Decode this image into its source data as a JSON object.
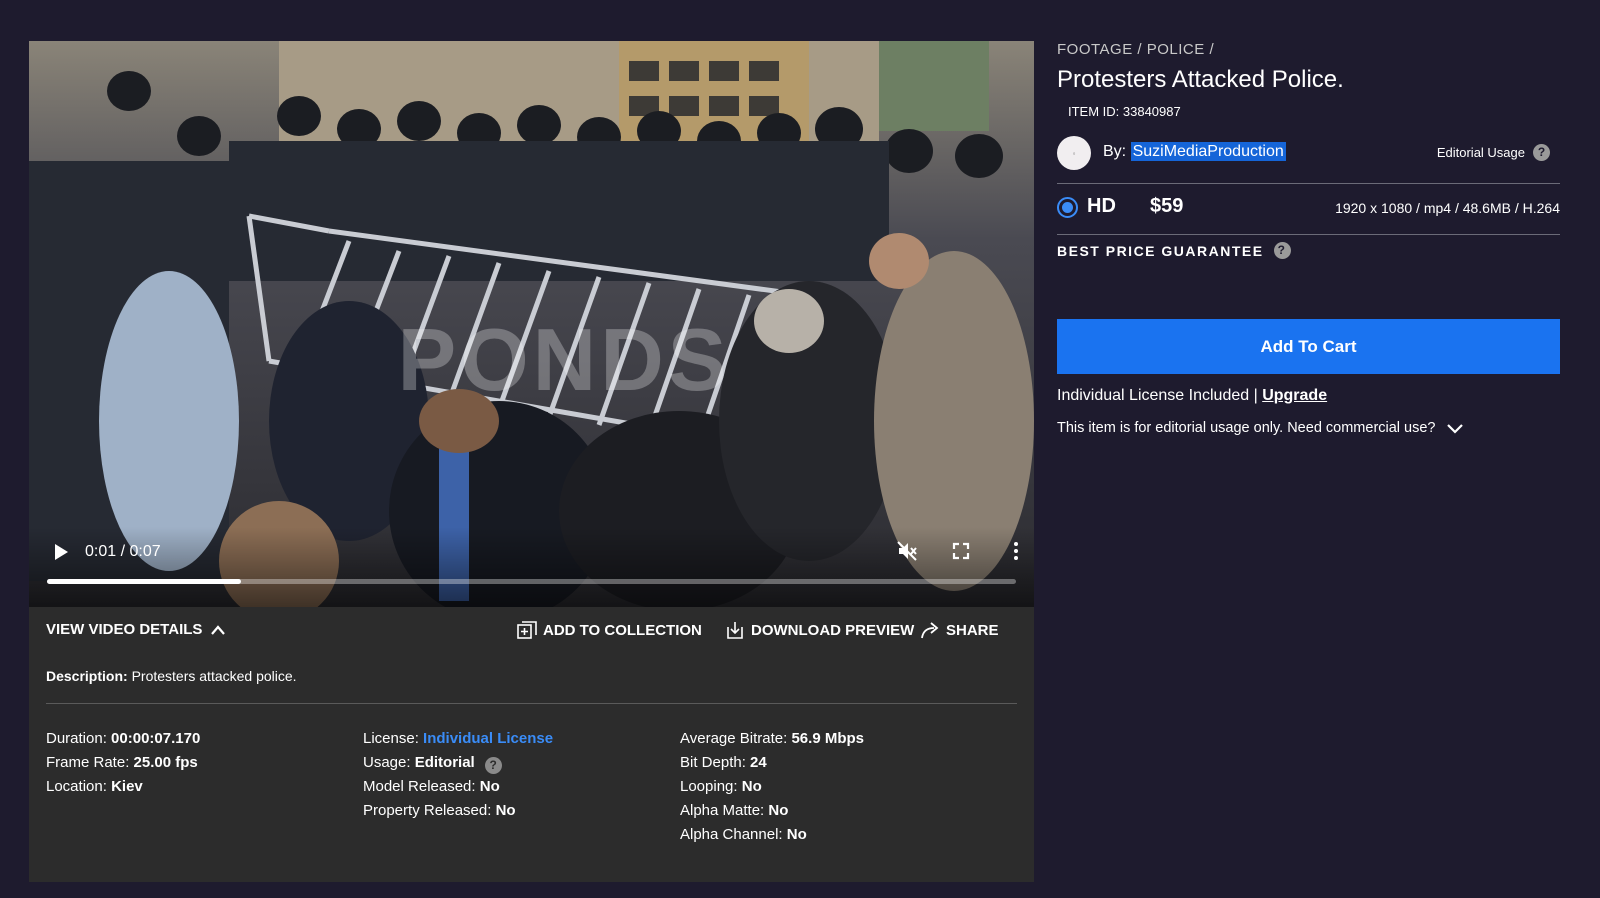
{
  "video": {
    "watermark": "PONDS",
    "time_current": "0:01",
    "time_separator": "/",
    "time_total": "0:07",
    "progress_fraction": 0.2
  },
  "details_bar": {
    "view_details": "VIEW VIDEO DETAILS",
    "add_to_collection": "ADD TO COLLECTION",
    "download_preview": "DOWNLOAD PREVIEW",
    "share": "SHARE"
  },
  "description": {
    "label": "Description:",
    "text": "Protesters attacked police."
  },
  "meta": {
    "col1": [
      {
        "label": "Duration:",
        "value": "00:00:07.170"
      },
      {
        "label": "Frame Rate:",
        "value": "25.00 fps"
      },
      {
        "label": "Location:",
        "value": "Kiev"
      }
    ],
    "license_label": "License:",
    "license_value": "Individual License",
    "usage_label": "Usage:",
    "usage_value": "Editorial",
    "col2_rest": [
      {
        "label": "Model Released:",
        "value": "No"
      },
      {
        "label": "Property Released:",
        "value": "No"
      }
    ],
    "col3": [
      {
        "label": "Average Bitrate:",
        "value": "56.9 Mbps"
      },
      {
        "label": "Bit Depth:",
        "value": "24"
      },
      {
        "label": "Looping:",
        "value": "No"
      },
      {
        "label": "Alpha Matte:",
        "value": "No"
      },
      {
        "label": "Alpha Channel:",
        "value": "No"
      }
    ]
  },
  "sidebar": {
    "breadcrumb": [
      "FOOTAGE",
      "POLICE"
    ],
    "breadcrumb_separator": "/",
    "title": "Protesters Attacked Police.",
    "item_id": "ITEM ID: 33840987",
    "by_label": "By:",
    "author": "SuziMediaProduction",
    "editorial_usage": "Editorial Usage",
    "format": "HD",
    "price": "$59",
    "specs": "1920 x 1080 / mp4 / 48.6MB / H.264",
    "best_price": "BEST PRICE GUARANTEE",
    "add_to_cart": "Add To Cart",
    "license_included": "Individual License Included",
    "license_divider": "|",
    "upgrade": "Upgrade",
    "editorial_note": "This item is for editorial usage only. Need commercial use?"
  },
  "colors": {
    "page_bg": "#1e1b2e",
    "panel_bg": "#2c2c2c",
    "accent_blue": "#1a73f0",
    "link_blue": "#3a8cf7"
  },
  "icons": [
    "play-icon",
    "mute-icon",
    "fullscreen-icon",
    "more-vertical-icon",
    "chevron-up-icon",
    "add-collection-icon",
    "download-icon",
    "share-icon",
    "help-icon",
    "chevron-down-icon"
  ]
}
